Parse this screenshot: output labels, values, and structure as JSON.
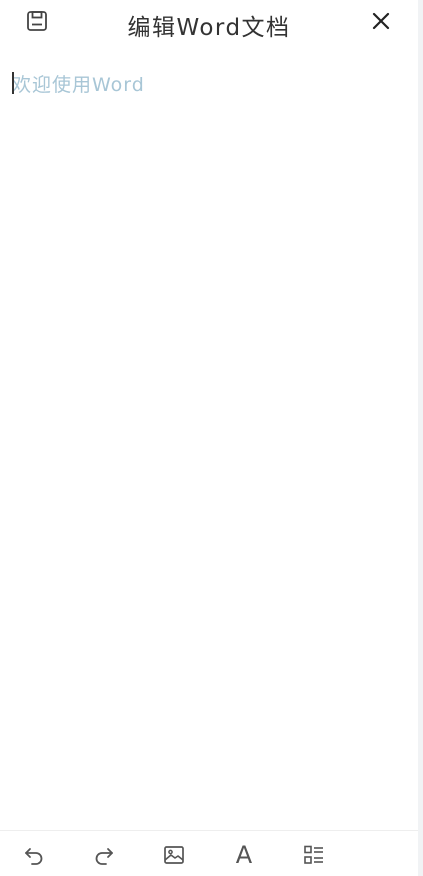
{
  "header": {
    "title": "编辑Word文档",
    "save_icon": "floppy-disk-icon",
    "close_icon": "close-icon"
  },
  "editor": {
    "placeholder": "欢迎使用Word"
  },
  "toolbar": {
    "items": [
      {
        "name": "undo",
        "icon": "undo-icon"
      },
      {
        "name": "redo",
        "icon": "redo-icon"
      },
      {
        "name": "insert-image",
        "icon": "image-icon"
      },
      {
        "name": "font",
        "icon": "font-icon",
        "glyph": "A"
      },
      {
        "name": "list-format",
        "icon": "list-icon"
      }
    ]
  },
  "colors": {
    "title": "#333333",
    "placeholder": "#a8c6d6",
    "icon": "#555555"
  }
}
